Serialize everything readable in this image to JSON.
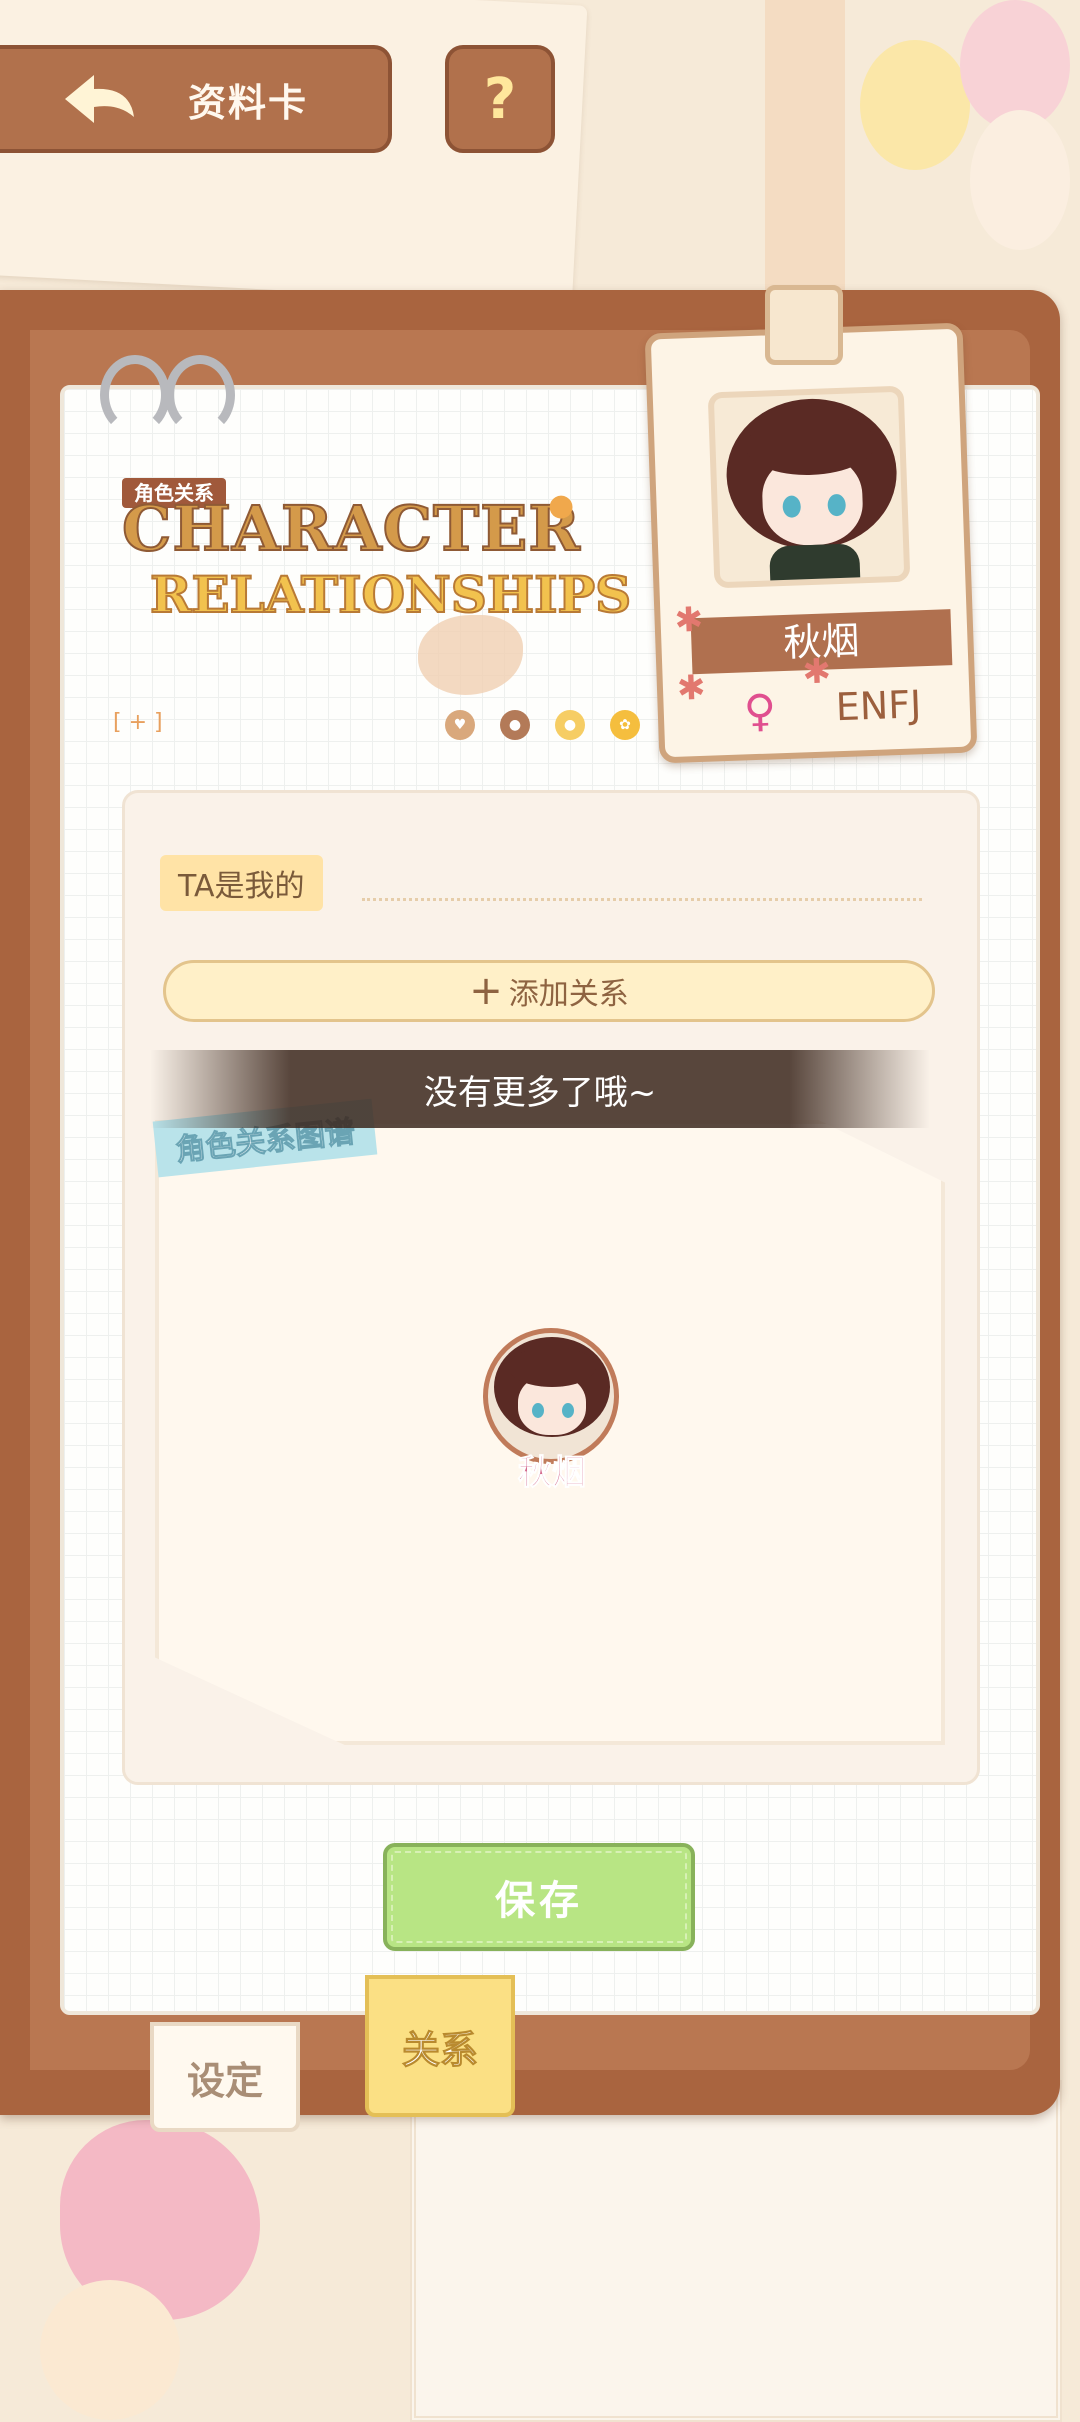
{
  "topbar": {
    "back_label": "资料卡",
    "help_label": "?"
  },
  "header": {
    "tag": "角色关系",
    "title_line1": "CHARACTER",
    "title_line2": "RELATIONSHIPS",
    "bracket": "[ + ]"
  },
  "card": {
    "name": "秋烟",
    "gender_icon": "♀",
    "mbti": "ENFJ"
  },
  "relations": {
    "ta_label": "TA是我的",
    "add_button": "添加关系",
    "toast": "没有更多了哦~",
    "graph_tag": "角色关系图谱",
    "node_name": "秋烟"
  },
  "actions": {
    "save": "保存"
  },
  "tabs": [
    {
      "label": "设定"
    },
    {
      "label": "关系"
    }
  ],
  "colors": {
    "board": "#a9643f",
    "accent_yellow": "#fbe084",
    "save_green": "#b8e584",
    "toast_bg": "#3c281e"
  }
}
